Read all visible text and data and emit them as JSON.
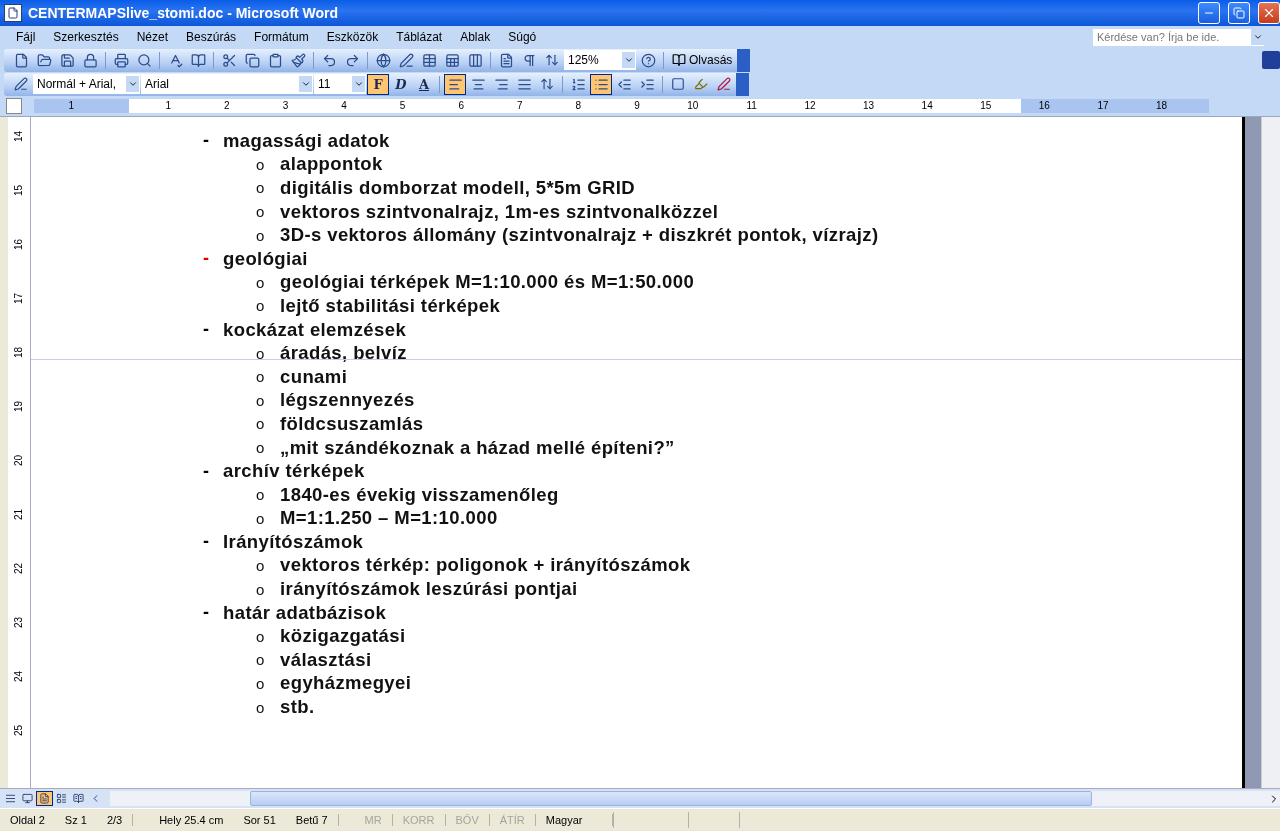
{
  "window": {
    "title": "CENTERMAPSlive_stomi.doc - Microsoft Word"
  },
  "menu": [
    "Fájl",
    "Szerkesztés",
    "Nézet",
    "Beszúrás",
    "Formátum",
    "Eszközök",
    "Táblázat",
    "Ablak",
    "Súgó"
  ],
  "help_box": {
    "placeholder": "Kérdése van? Írja be ide."
  },
  "standard_toolbar": {
    "zoom": "125%",
    "reading_button": "Olvasás"
  },
  "formatting_toolbar": {
    "style": "Normál + Arial,",
    "font": "Arial",
    "size": "11",
    "format_buttons": [
      {
        "label": "F",
        "kind": "bold",
        "selected": true
      },
      {
        "label": "D",
        "kind": "italic",
        "selected": false
      },
      {
        "label": "A",
        "kind": "underline",
        "selected": false
      }
    ],
    "align_buttons": [
      {
        "kind": "left",
        "selected": true
      },
      {
        "kind": "center",
        "selected": false
      },
      {
        "kind": "right",
        "selected": false
      },
      {
        "kind": "justify",
        "selected": false
      }
    ],
    "list_buttons": [
      {
        "kind": "numbered",
        "selected": false
      },
      {
        "kind": "bulleted",
        "selected": true
      }
    ]
  },
  "ruler": [
    "1",
    "1",
    "2",
    "3",
    "4",
    "5",
    "6",
    "7",
    "8",
    "9",
    "10",
    "11",
    "12",
    "13",
    "14",
    "15",
    "16",
    "17",
    "18"
  ],
  "vertical_ruler": [
    "14",
    "15",
    "16",
    "17",
    "18",
    "19",
    "20",
    "21",
    "22",
    "23",
    "24",
    "25"
  ],
  "document": {
    "items": [
      {
        "marker": "-",
        "color": "#000000",
        "text": "magassági adatok",
        "children": [
          {
            "marker": "o",
            "text": "alappontok"
          },
          {
            "marker": "o",
            "text": "digitális domborzat modell, 5*5m GRID"
          },
          {
            "marker": "o",
            "text": "vektoros szintvonalrajz, 1m-es szintvonalközzel"
          },
          {
            "marker": "o",
            "text": "3D-s vektoros állomány (szintvonalrajz + diszkrét pontok, vízrajz)"
          }
        ]
      },
      {
        "marker": "-",
        "color": "#e00000",
        "text": "geológiai",
        "children": [
          {
            "marker": "o",
            "text": "geológiai térképek M=1:10.000 és M=1:50.000"
          },
          {
            "marker": "o",
            "text": "lejtő stabilitási térképek"
          }
        ]
      },
      {
        "marker": "-",
        "color": "#000000",
        "text": "kockázat elemzések",
        "children": [
          {
            "marker": "o",
            "text": "áradás, belvíz"
          },
          {
            "marker": "o",
            "text": "cunami"
          },
          {
            "marker": "o",
            "text": "légszennyezés"
          },
          {
            "marker": "o",
            "text": "földcsuszamlás"
          },
          {
            "marker": "o",
            "text": "„mit szándékoznak a házad mellé építeni?”"
          }
        ]
      },
      {
        "marker": "-",
        "color": "#000000",
        "text": "archív térképek",
        "children": [
          {
            "marker": "o",
            "text": "1840-es évekig visszamenőleg"
          },
          {
            "marker": "o",
            "text": "M=1:1.250 – M=1:10.000"
          }
        ]
      },
      {
        "marker": "-",
        "color": "#000000",
        "text": "Irányítószámok",
        "children": [
          {
            "marker": "o",
            "text": "vektoros térkép: poligonok + irányítószámok"
          },
          {
            "marker": "o",
            "text": "irányítószámok leszúrási pontjai"
          }
        ]
      },
      {
        "marker": "-",
        "color": "#000000",
        "text": "határ adatbázisok",
        "children": [
          {
            "marker": "o",
            "text": "közigazgatási"
          },
          {
            "marker": "o",
            "text": "választási"
          },
          {
            "marker": "o",
            "text": "egyházmegyei"
          },
          {
            "marker": "o",
            "text": "stb."
          }
        ]
      }
    ]
  },
  "view_buttons": [
    {
      "kind": "normal",
      "selected": false
    },
    {
      "kind": "web",
      "selected": false
    },
    {
      "kind": "print",
      "selected": true
    },
    {
      "kind": "outline",
      "selected": false
    },
    {
      "kind": "reading",
      "selected": false
    }
  ],
  "status_bar": {
    "fields": [
      "Oldal 2",
      "Sz 1",
      "2/3",
      "Hely 25.4 cm",
      "Sor 51",
      "Betű 7"
    ],
    "modes": [
      {
        "label": "MR",
        "on": false
      },
      {
        "label": "KORR",
        "on": false
      },
      {
        "label": "BŐV",
        "on": false
      },
      {
        "label": "ÁTÍR",
        "on": false
      }
    ],
    "language": "Magyar"
  }
}
